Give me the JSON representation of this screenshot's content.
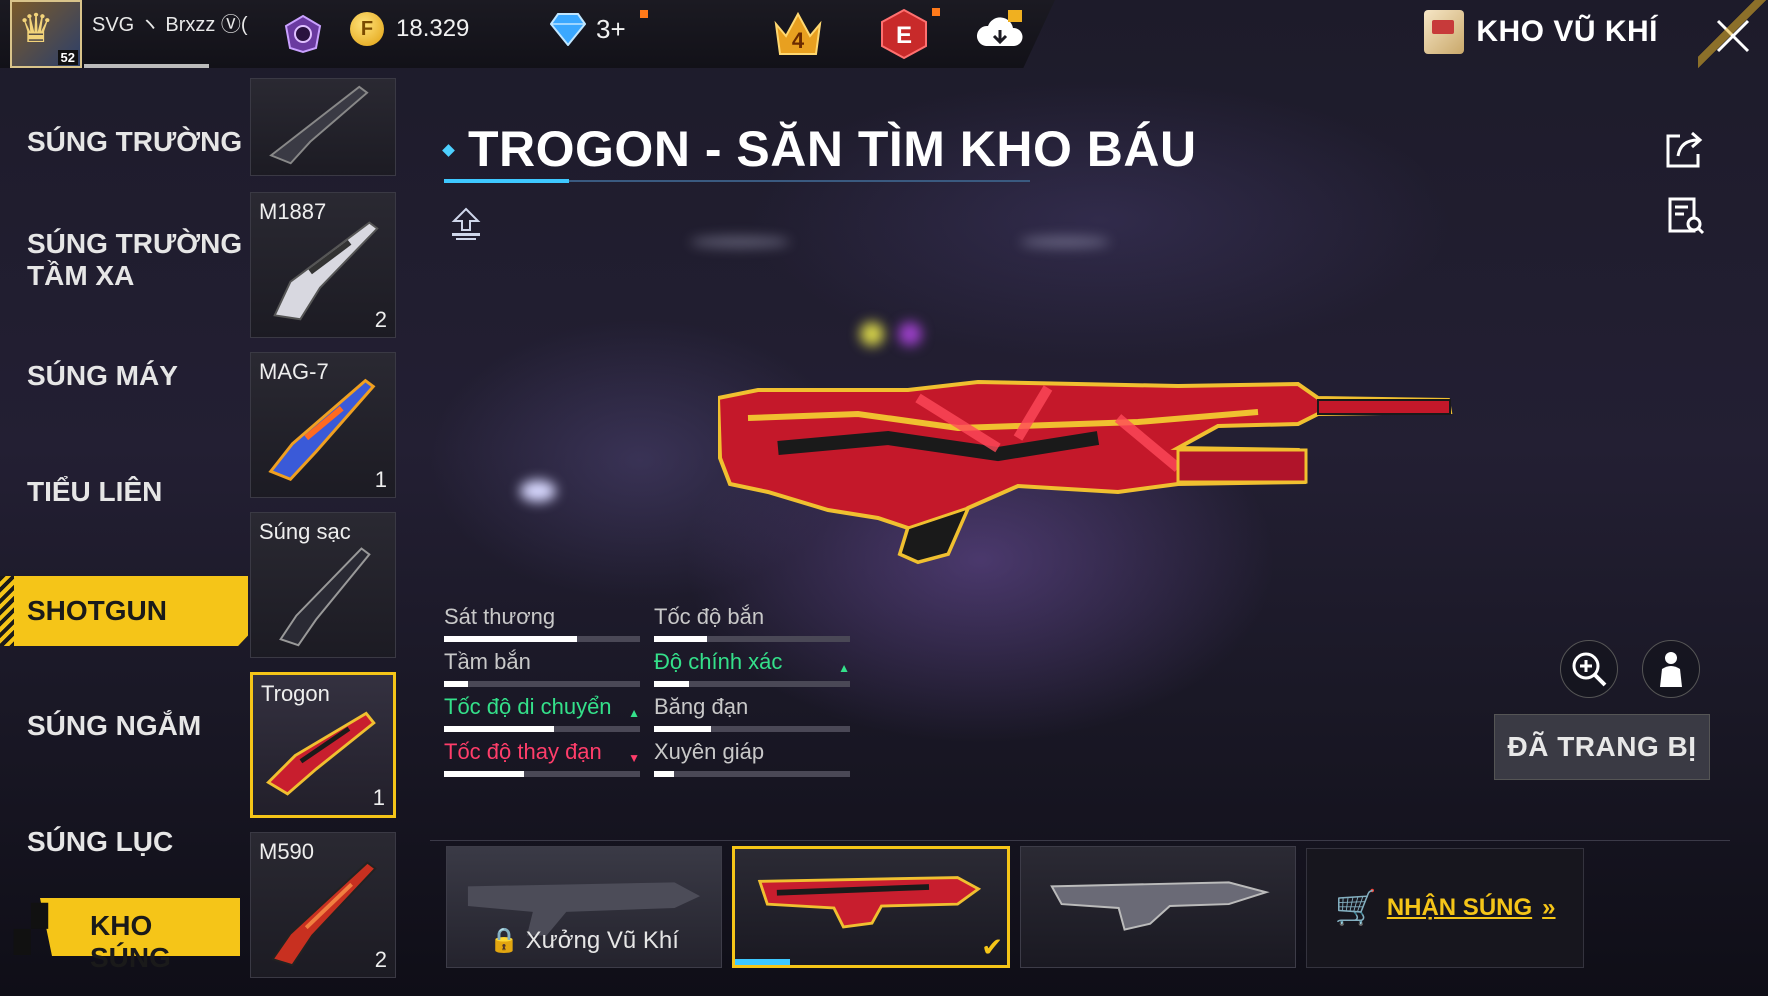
{
  "header": {
    "player_name": "SVG ヽ Brxzz Ⓥ(",
    "player_level": "52",
    "gold": "18.329",
    "diamonds": "3+",
    "badge_level": "4",
    "badge_letter": "E",
    "screen_title": "KHO VŨ KHÍ"
  },
  "categories": [
    {
      "label": "SÚNG TRƯỜNG",
      "active": false
    },
    {
      "label": "SÚNG TRƯỜNG\nTẦM XA",
      "active": false
    },
    {
      "label": "SÚNG MÁY",
      "active": false
    },
    {
      "label": "TIỂU LIÊN",
      "active": false
    },
    {
      "label": "SHOTGUN",
      "active": true
    },
    {
      "label": "SÚNG NGẮM",
      "active": false
    },
    {
      "label": "SÚNG LỤC",
      "active": false
    }
  ],
  "footer_button": "KHO SÚNG",
  "weapons": [
    {
      "name": "",
      "count": ""
    },
    {
      "name": "M1887",
      "count": "2"
    },
    {
      "name": "MAG-7",
      "count": "1"
    },
    {
      "name": "Súng sạc",
      "count": ""
    },
    {
      "name": "Trogon",
      "count": "1",
      "selected": true
    },
    {
      "name": "M590",
      "count": "2"
    }
  ],
  "weapon_title": "TROGON - SĂN TÌM KHO BÁU",
  "stats": [
    {
      "label": "Sát thương",
      "value": 0.68,
      "trend": "none"
    },
    {
      "label": "Tốc độ bắn",
      "value": 0.27,
      "trend": "none"
    },
    {
      "label": "Tầm bắn",
      "value": 0.12,
      "trend": "none"
    },
    {
      "label": "Độ chính xác",
      "value": 0.18,
      "trend": "up"
    },
    {
      "label": "Tốc độ di chuyển",
      "value": 0.56,
      "trend": "up"
    },
    {
      "label": "Băng đạn",
      "value": 0.29,
      "trend": "none"
    },
    {
      "label": "Tốc độ thay đạn",
      "value": 0.41,
      "trend": "down"
    },
    {
      "label": "Xuyên giáp",
      "value": 0.1,
      "trend": "none"
    }
  ],
  "equipped_label": "ĐÃ TRANG BỊ",
  "skins": {
    "workshop_label": "Xưởng Vũ Khí",
    "buy_label": "NHẬN SÚNG"
  },
  "colors": {
    "accent": "#f5c518",
    "stat_up": "#34e08a",
    "stat_down": "#ff3d6a",
    "title_underline": "#3ec8ff"
  }
}
